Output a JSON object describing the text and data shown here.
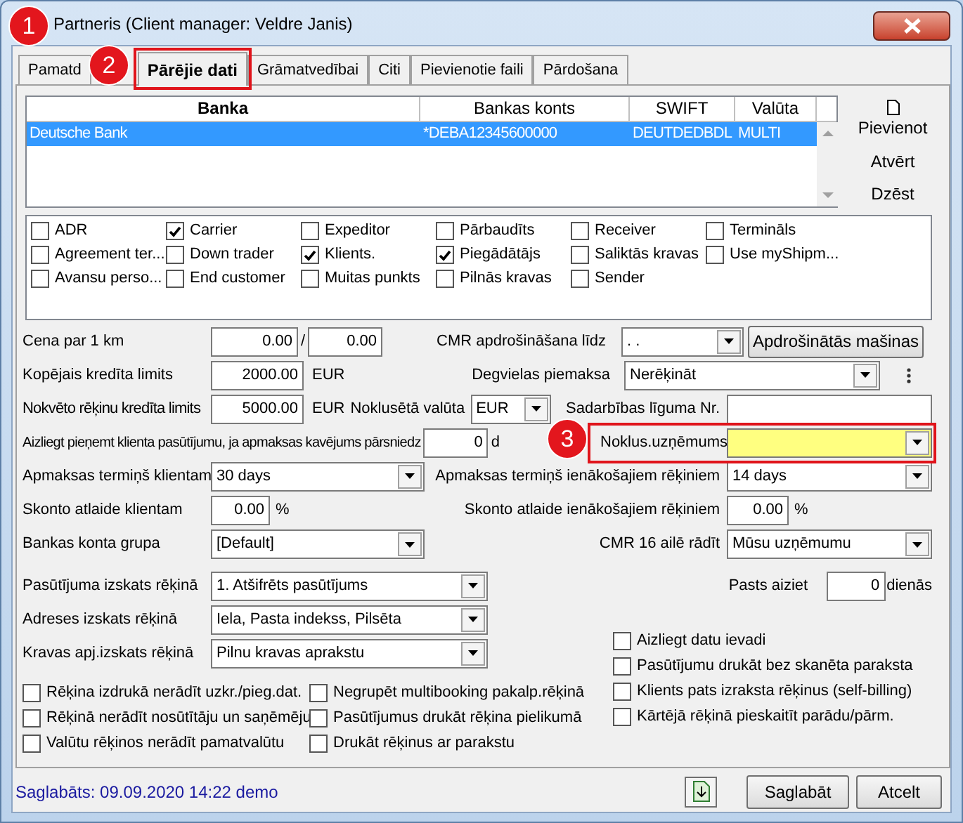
{
  "window": {
    "title": "Partneris (Client manager: Veldre Janis)"
  },
  "annotations": [
    {
      "label": "1"
    },
    {
      "label": "2"
    },
    {
      "label": "3"
    }
  ],
  "tabs": [
    {
      "label": "Pamatd",
      "selected": false,
      "highlighted": false
    },
    {
      "label": "Pārējie dati",
      "selected": true,
      "highlighted": true
    },
    {
      "label": "Grāmatvedībai",
      "selected": false,
      "highlighted": false
    },
    {
      "label": "Citi",
      "selected": false,
      "highlighted": false
    },
    {
      "label": "Pievienotie faili",
      "selected": false,
      "highlighted": false
    },
    {
      "label": "Pārdošana",
      "selected": false,
      "highlighted": false
    }
  ],
  "bank_table": {
    "columns": [
      "Banka",
      "Bankas konts",
      "SWIFT",
      "Valūta"
    ],
    "rows": [
      {
        "cells": [
          "Deutsche Bank",
          "*DEBA12345600000",
          "DEUTDEDBDL",
          "MULTI"
        ],
        "selected": true
      }
    ]
  },
  "bank_buttons": [
    "Pievienot",
    "Atvērt",
    "Dzēst"
  ],
  "partner_types": [
    {
      "label": "ADR",
      "checked": false
    },
    {
      "label": "Carrier",
      "checked": true
    },
    {
      "label": "Expeditor",
      "checked": false
    },
    {
      "label": "Pārbaudīts",
      "checked": false
    },
    {
      "label": "Receiver",
      "checked": false
    },
    {
      "label": "Termināls",
      "checked": false
    },
    {
      "label": "Agreement ter...",
      "checked": false
    },
    {
      "label": "Down trader",
      "checked": false
    },
    {
      "label": "Klients.",
      "checked": true
    },
    {
      "label": "Piegādātājs",
      "checked": true
    },
    {
      "label": "Saliktās kravas",
      "checked": false
    },
    {
      "label": "Use myShipm...",
      "checked": false
    },
    {
      "label": "Avansu perso...",
      "checked": false
    },
    {
      "label": "End customer",
      "checked": false
    },
    {
      "label": "Muitas punkts",
      "checked": false
    },
    {
      "label": "Pilnās kravas",
      "checked": false
    },
    {
      "label": "Sender",
      "checked": false
    }
  ],
  "form": {
    "price_per_km": {
      "label": "Cena par 1 km",
      "value": "0.00",
      "separator": "/",
      "value_2": "0.00"
    },
    "cmr_insurance": {
      "label": "CMR apdrošināšana līdz",
      "value": ". .",
      "button": "Apdrošinātās mašinas"
    },
    "total_credit_limit": {
      "label": "Kopējais kredīta limits",
      "value": "2000.00",
      "currency": "EUR"
    },
    "fuel_surcharge": {
      "label": "Degvielas piemaksa",
      "value": "Nerēķināt"
    },
    "unpaid_credit_limit": {
      "label": "Nokvēto rēķinu kredīta limits",
      "value": "5000.00",
      "currency": "EUR"
    },
    "default_currency": {
      "label": "Noklusētā valūta",
      "value": "EUR"
    },
    "contract_no": {
      "label": "Sadarbības līguma Nr."
    },
    "overdue_block": {
      "label": "Aizliegt pieņemt klienta pasūtījumu, ja apmaksas kavējums pārsniedz",
      "value": "0",
      "unit": "d"
    },
    "default_company": {
      "label": "Noklus.uzņēmums",
      "highlighted": true
    },
    "client_payment_term": {
      "label": "Apmaksas termiņš klientam",
      "value": "30 days"
    },
    "incoming_payment_term": {
      "label": "Apmaksas termiņš ienākošajiem rēķiniem",
      "value": "14 days"
    },
    "client_discount": {
      "label": "Skonto atlaide klientam",
      "value": "0.00",
      "unit": "%"
    },
    "incoming_discount": {
      "label": "Skonto atlaide ienākošajiem rēķiniem",
      "value": "0.00",
      "unit": "%"
    },
    "bank_account_group": {
      "label": "Bankas konta grupa",
      "value": "[Default]"
    },
    "cmr_box16": {
      "label": "CMR 16 ailē rādīt",
      "value": "Mūsu uzņēmumu"
    },
    "order_view": {
      "label": "Pasūtījuma izskats rēķinā",
      "value": "1. Atšifrēts pasūtījums"
    },
    "mail_departs": {
      "label": "Pasts aiziet",
      "value": "0",
      "unit": "dienās"
    },
    "address_view": {
      "label": "Adreses izskats rēķinā",
      "value": "Iela, Pasta indekss, Pilsēta"
    },
    "cargo_view": {
      "label": "Kravas apj.izskats rēķinā",
      "value": "Pilnu kravas aprakstu"
    }
  },
  "invoice_options": [
    [
      {
        "label": "Rēķina izdrukā nerādīt uzkr./pieg.dat.",
        "checked": false
      },
      {
        "label": "Rēķinā nerādīt nosūtītāju un saņēmēju",
        "checked": false
      },
      {
        "label": "Valūtu rēķinos nerādīt pamatvalūtu",
        "checked": false
      }
    ],
    [
      {
        "label": "Negrupēt multibooking pakalp.rēķinā",
        "checked": false
      },
      {
        "label": "Pasūtījumus drukāt rēķina pielikumā",
        "checked": false
      },
      {
        "label": "Drukāt rēķinus ar parakstu",
        "checked": false
      }
    ],
    [
      {
        "label": "Aizliegt datu ievadi",
        "checked": false
      },
      {
        "label": "Pasūtījumu drukāt bez skanēta paraksta",
        "checked": false
      },
      {
        "label": "Klients pats izraksta rēķinus (self-billing)",
        "checked": false
      },
      {
        "label": "Kārtējā rēķinā pieskaitīt parādu/pārm.",
        "checked": false
      }
    ]
  ],
  "status": "Saglabāts: 09.09.2020 14:22 demo",
  "buttons": [
    "Saglabāt",
    "Atcelt"
  ]
}
